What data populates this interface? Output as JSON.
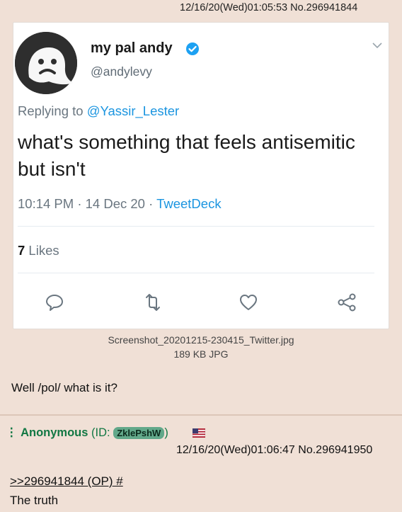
{
  "op": {
    "meta": "12/16/20(Wed)01:05:53 No.296941844",
    "file_name": "Screenshot_20201215-230415_Twitter.jpg",
    "file_size": "189 KB JPG",
    "text": "Well /pol/ what is it?"
  },
  "tweet": {
    "display_name": "my pal andy",
    "handle": "@andylevy",
    "replying_prefix": "Replying to ",
    "replying_mention": "@Yassir_Lester",
    "text": "what's something that feels antisemitic but isn't",
    "time_date": "10:14 PM · 14 Dec 20 · ",
    "client": "TweetDeck",
    "likes_count": "7",
    "likes_label": " Likes",
    "verified_color": "#1da1f2",
    "icons": [
      "caret-down-icon",
      "comment-icon",
      "retweet-icon",
      "heart-icon",
      "share-icon"
    ]
  },
  "reply": {
    "name": "Anonymous",
    "id_prefix": "(ID: ",
    "poster_id": "ZklePshW",
    "id_suffix": ")",
    "meta": "12/16/20(Wed)01:06:47 No.296941950",
    "quote_link": ">>296941844 (OP) #",
    "text": "The truth"
  }
}
